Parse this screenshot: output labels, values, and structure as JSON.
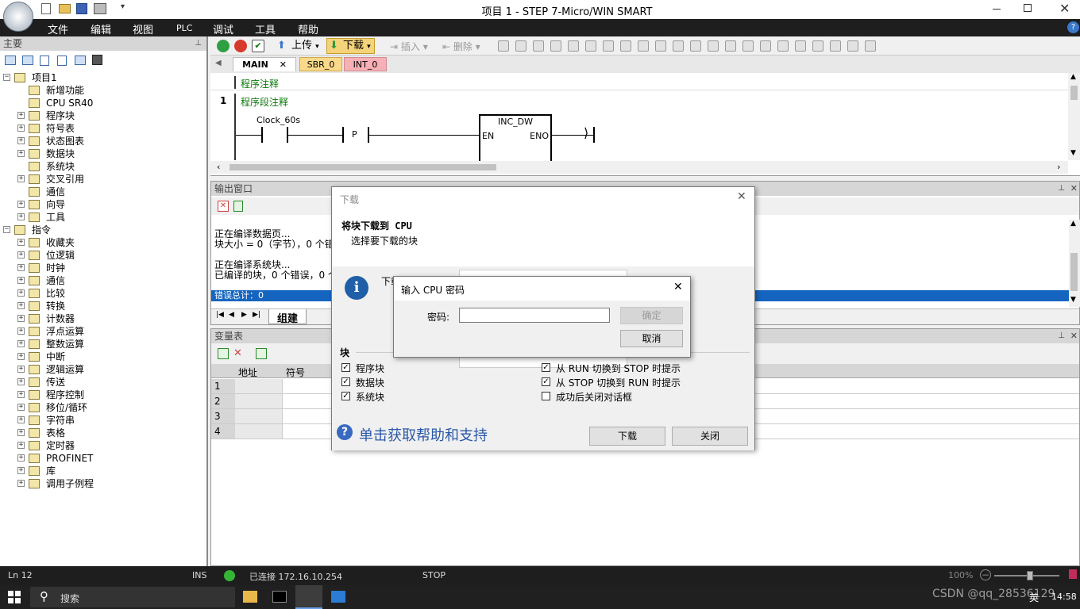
{
  "window": {
    "title": "项目 1 - STEP 7-Micro/WIN SMART"
  },
  "menu": [
    "文件",
    "编辑",
    "视图",
    "PLC",
    "调试",
    "工具",
    "帮助"
  ],
  "left_panel": {
    "header": "主要",
    "tree": [
      {
        "label": "项目1",
        "indent": 0,
        "expander": "−"
      },
      {
        "label": "新增功能",
        "indent": 1,
        "expander": ""
      },
      {
        "label": "CPU SR40",
        "indent": 1,
        "expander": ""
      },
      {
        "label": "程序块",
        "indent": 1,
        "expander": "+"
      },
      {
        "label": "符号表",
        "indent": 1,
        "expander": "+"
      },
      {
        "label": "状态图表",
        "indent": 1,
        "expander": "+"
      },
      {
        "label": "数据块",
        "indent": 1,
        "expander": "+"
      },
      {
        "label": "系统块",
        "indent": 1,
        "expander": ""
      },
      {
        "label": "交叉引用",
        "indent": 1,
        "expander": "+"
      },
      {
        "label": "通信",
        "indent": 1,
        "expander": ""
      },
      {
        "label": "向导",
        "indent": 1,
        "expander": "+"
      },
      {
        "label": "工具",
        "indent": 1,
        "expander": "+"
      },
      {
        "label": "指令",
        "indent": 0,
        "expander": "−"
      },
      {
        "label": "收藏夹",
        "indent": 1,
        "expander": "+"
      },
      {
        "label": "位逻辑",
        "indent": 1,
        "expander": "+"
      },
      {
        "label": "时钟",
        "indent": 1,
        "expander": "+"
      },
      {
        "label": "通信",
        "indent": 1,
        "expander": "+"
      },
      {
        "label": "比较",
        "indent": 1,
        "expander": "+"
      },
      {
        "label": "转换",
        "indent": 1,
        "expander": "+"
      },
      {
        "label": "计数器",
        "indent": 1,
        "expander": "+"
      },
      {
        "label": "浮点运算",
        "indent": 1,
        "expander": "+"
      },
      {
        "label": "整数运算",
        "indent": 1,
        "expander": "+"
      },
      {
        "label": "中断",
        "indent": 1,
        "expander": "+"
      },
      {
        "label": "逻辑运算",
        "indent": 1,
        "expander": "+"
      },
      {
        "label": "传送",
        "indent": 1,
        "expander": "+"
      },
      {
        "label": "程序控制",
        "indent": 1,
        "expander": "+"
      },
      {
        "label": "移位/循环",
        "indent": 1,
        "expander": "+"
      },
      {
        "label": "字符串",
        "indent": 1,
        "expander": "+"
      },
      {
        "label": "表格",
        "indent": 1,
        "expander": "+"
      },
      {
        "label": "定时器",
        "indent": 1,
        "expander": "+"
      },
      {
        "label": "PROFINET",
        "indent": 1,
        "expander": "+"
      },
      {
        "label": "库",
        "indent": 1,
        "expander": "+"
      },
      {
        "label": "调用子例程",
        "indent": 1,
        "expander": "+"
      }
    ]
  },
  "toolbar": {
    "upload_label": "上传",
    "download_label": "下载",
    "insert_label": "插入",
    "delete_label": "删除"
  },
  "editor": {
    "tabs": [
      "MAIN",
      "SBR_0",
      "INT_0"
    ],
    "program_comment": "程序注释",
    "network_number": "1",
    "network_comment": "程序段注释",
    "contact_label": "Clock_60s",
    "p_label": "P",
    "box_title": "INC_DW",
    "box_en": "EN",
    "box_eno": "ENO"
  },
  "output_window": {
    "title": "输出窗口",
    "lines": [
      "正在编译数据页...",
      "块大小 = 0（字节），0 个错",
      "",
      "正在编译系统块...",
      "已编译的块，0 个错误，0 个"
    ],
    "error_total": "错误总计：0",
    "tab": "组建"
  },
  "var_table": {
    "title": "变量表",
    "headers": [
      "地址",
      "符号"
    ],
    "rows": [
      "1",
      "2",
      "3",
      "4"
    ]
  },
  "download_dialog": {
    "title": "下载",
    "heading": "将块下载到 CPU",
    "subheading": "选择要下载的块",
    "hidden_label": "下载",
    "blocks_header": "块",
    "blocks": [
      {
        "label": "程序块",
        "checked": true
      },
      {
        "label": "数据块",
        "checked": true
      },
      {
        "label": "系统块",
        "checked": true
      }
    ],
    "options": [
      {
        "label": "从 RUN 切换到 STOP 时提示",
        "checked": true
      },
      {
        "label": "从 STOP 切换到 RUN 时提示",
        "checked": true
      },
      {
        "label": "成功后关闭对话框",
        "checked": false
      }
    ],
    "help_link": "单击获取帮助和支持",
    "download_button": "下载",
    "close_button": "关闭"
  },
  "password_dialog": {
    "title": "输入 CPU 密码",
    "password_label": "密码:",
    "password_value": "",
    "ok_button": "确定",
    "cancel_button": "取消"
  },
  "status_bar": {
    "line": "Ln 12",
    "ins": "INS",
    "connection": "已连接 172.16.10.254",
    "mode": "STOP",
    "zoom": "100%"
  },
  "taskbar": {
    "search": "搜索",
    "watermark": "CSDN @qq_28536129",
    "time": "14:58",
    "ime": "英"
  }
}
